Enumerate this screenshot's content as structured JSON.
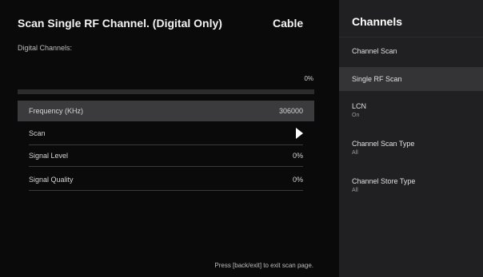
{
  "screen": {
    "title": "Scan Single RF Channel. (Digital Only)",
    "source": "Cable",
    "subtitle": "Digital Channels:",
    "progress_percent": "0%",
    "progress_fraction": 0,
    "rows": {
      "frequency": {
        "label": "Frequency (KHz)",
        "value": "306000"
      },
      "scan": {
        "label": "Scan",
        "icon": "play-icon"
      },
      "signal_level": {
        "label": "Signal Level",
        "value": "0%"
      },
      "signal_quality": {
        "label": "Signal Quality",
        "value": "0%"
      }
    },
    "footer_hint": "Press [back/exit] to exit scan page."
  },
  "sidebar": {
    "title": "Channels",
    "items": [
      {
        "label": "Channel Scan",
        "sub": ""
      },
      {
        "label": "Single RF Scan",
        "sub": ""
      },
      {
        "label": "LCN",
        "sub": "On"
      },
      {
        "label": "Channel Scan Type",
        "sub": "All"
      },
      {
        "label": "Channel Store Type",
        "sub": "All"
      }
    ]
  },
  "colors": {
    "background": "#0a0a0a",
    "sidebar_background": "#202022",
    "focused_row": "#3b3b3d",
    "active_sidebar_item": "#343436"
  }
}
